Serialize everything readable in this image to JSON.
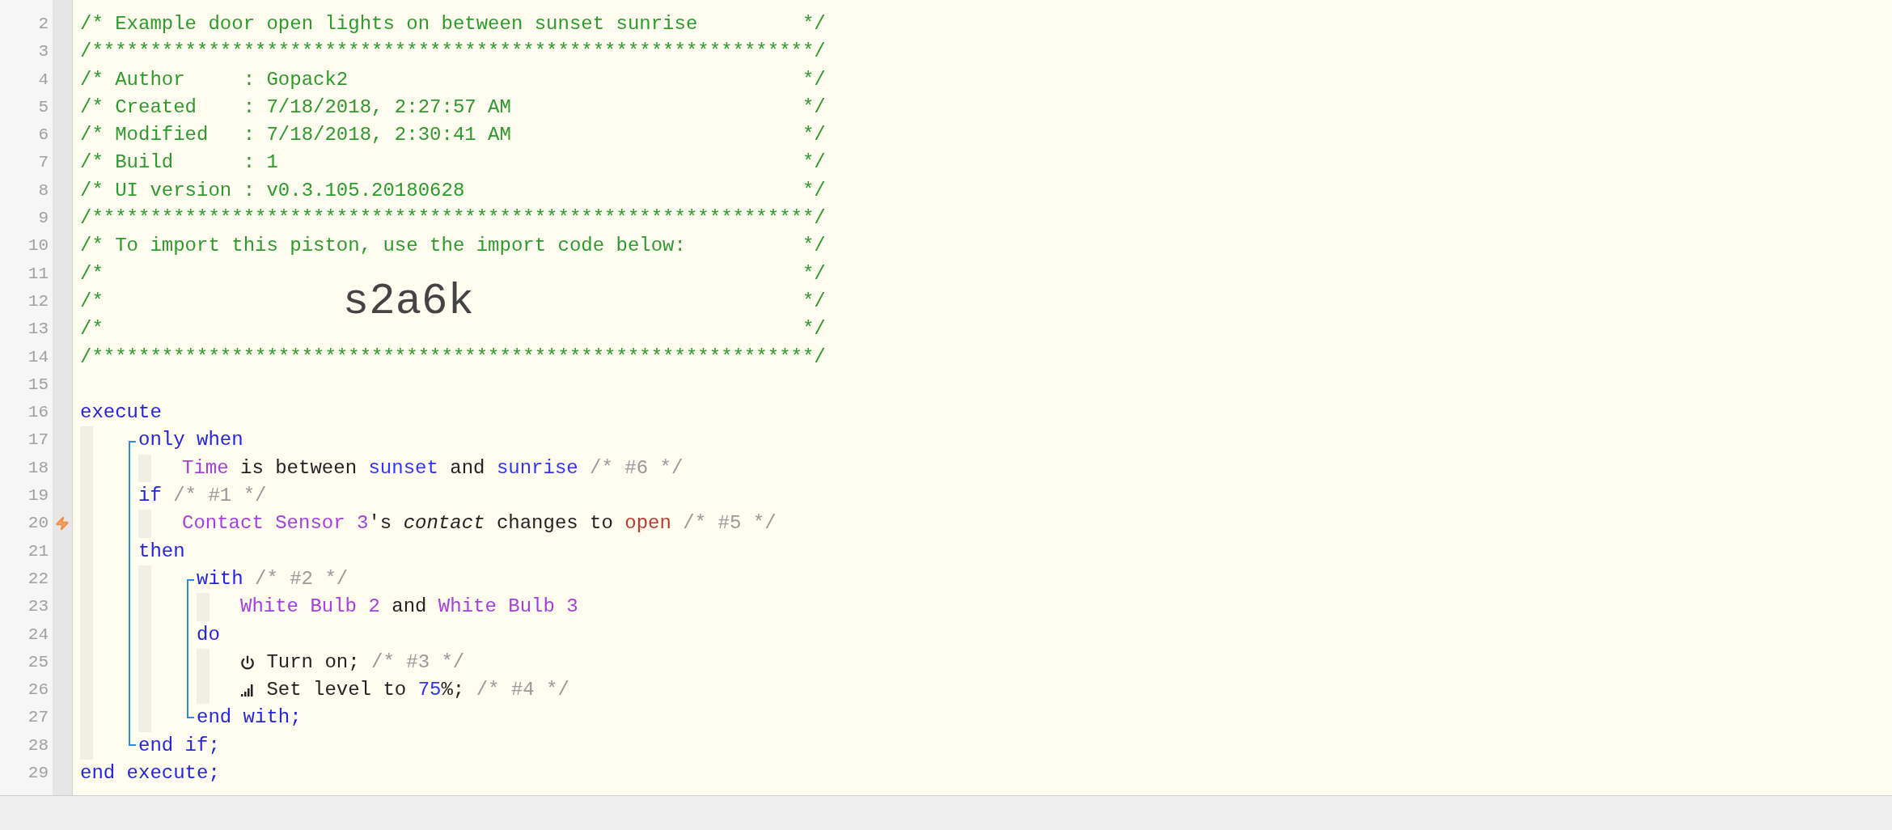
{
  "editor": {
    "header_lines": [
      {
        "number": "2",
        "trigger": false,
        "cols": [
          "/* Example door open lights on between sunset sunrise",
          "*/"
        ]
      },
      {
        "number": "3",
        "trigger": false,
        "cols": [
          "/**************************************************************/"
        ]
      },
      {
        "number": "4",
        "trigger": false,
        "cols": [
          "/* Author     : Gopack2",
          "*/"
        ]
      },
      {
        "number": "5",
        "trigger": false,
        "cols": [
          "/* Created    : 7/18/2018, 2:27:57 AM",
          "*/"
        ]
      },
      {
        "number": "6",
        "trigger": false,
        "cols": [
          "/* Modified   : 7/18/2018, 2:30:41 AM",
          "*/"
        ]
      },
      {
        "number": "7",
        "trigger": false,
        "cols": [
          "/* Build      : 1",
          "*/"
        ]
      },
      {
        "number": "8",
        "trigger": false,
        "cols": [
          "/* UI version : v0.3.105.20180628",
          "*/"
        ]
      },
      {
        "number": "9",
        "trigger": false,
        "cols": [
          "/**************************************************************/"
        ]
      },
      {
        "number": "10",
        "trigger": false,
        "cols": [
          "/* To import this piston, use the import code below:",
          "*/"
        ]
      },
      {
        "number": "11",
        "trigger": false,
        "cols": [
          "/*",
          "*/"
        ]
      },
      {
        "number": "12",
        "trigger": false,
        "cols": [
          "/*",
          "*/"
        ],
        "import_code": "s2a6k"
      },
      {
        "number": "13",
        "trigger": false,
        "cols": [
          "/*",
          "*/"
        ]
      },
      {
        "number": "14",
        "trigger": false,
        "cols": [
          "/**************************************************************/"
        ]
      },
      {
        "number": "15",
        "trigger": false
      }
    ],
    "code": [
      {
        "number": "16",
        "trigger": false,
        "segments": [
          {
            "kind": "keyword",
            "text": "execute"
          }
        ],
        "children": [
          {
            "kind": "block",
            "children": [
              {
                "number": "17",
                "trigger": false,
                "segments": [
                  {
                    "kind": "keyword",
                    "text": "only when"
                  }
                ],
                "children": [
                  {
                    "number": "18",
                    "trigger": false,
                    "segments": [
                      {
                        "kind": "device",
                        "text": "Time"
                      },
                      {
                        "kind": "plain",
                        "text": " is between "
                      },
                      {
                        "kind": "value",
                        "text": "sunset"
                      },
                      {
                        "kind": "plain",
                        "text": " and "
                      },
                      {
                        "kind": "value",
                        "text": "sunrise"
                      },
                      {
                        "kind": "note",
                        "text": " /* #6 */"
                      }
                    ]
                  }
                ]
              },
              {
                "number": "19",
                "trigger": false,
                "segments": [
                  {
                    "kind": "keyword",
                    "text": "if"
                  },
                  {
                    "kind": "note",
                    "text": " /* #1 */"
                  }
                ],
                "children": [
                  {
                    "number": "20",
                    "trigger": true,
                    "segments": [
                      {
                        "kind": "device",
                        "text": "Contact Sensor 3"
                      },
                      {
                        "kind": "plain",
                        "text": "'s "
                      },
                      {
                        "kind": "italic",
                        "text": "contact"
                      },
                      {
                        "kind": "plain",
                        "text": " changes to "
                      },
                      {
                        "kind": "state",
                        "text": "open"
                      },
                      {
                        "kind": "note",
                        "text": " /* #5 */"
                      }
                    ]
                  }
                ]
              },
              {
                "number": "21",
                "trigger": false,
                "segments": [
                  {
                    "kind": "keyword",
                    "text": "then"
                  }
                ],
                "children": [
                  {
                    "kind": "block",
                    "children": [
                      {
                        "number": "22",
                        "trigger": false,
                        "segments": [
                          {
                            "kind": "keyword",
                            "text": "with"
                          },
                          {
                            "kind": "note",
                            "text": " /* #2 */"
                          }
                        ],
                        "children": [
                          {
                            "number": "23",
                            "trigger": false,
                            "segments": [
                              {
                                "kind": "device",
                                "text": "White Bulb 2"
                              },
                              {
                                "kind": "plain",
                                "text": " and "
                              },
                              {
                                "kind": "device",
                                "text": "White Bulb 3"
                              }
                            ]
                          }
                        ]
                      },
                      {
                        "number": "24",
                        "trigger": false,
                        "segments": [
                          {
                            "kind": "keyword",
                            "text": "do"
                          }
                        ],
                        "children": [
                          {
                            "number": "25",
                            "trigger": false,
                            "segments": [
                              {
                                "kind": "power_icon"
                              },
                              {
                                "kind": "plain",
                                "text": " Turn on;"
                              },
                              {
                                "kind": "note",
                                "text": " /* #3 */"
                              }
                            ]
                          },
                          {
                            "number": "26",
                            "trigger": false,
                            "segments": [
                              {
                                "kind": "level_icon"
                              },
                              {
                                "kind": "plain",
                                "text": " Set level to "
                              },
                              {
                                "kind": "value",
                                "text": "75"
                              },
                              {
                                "kind": "plain",
                                "text": "%;"
                              },
                              {
                                "kind": "note",
                                "text": " /* #4 */"
                              }
                            ]
                          }
                        ]
                      },
                      {
                        "number": "27",
                        "trigger": false,
                        "segments": [
                          {
                            "kind": "keyword",
                            "text": "end with;"
                          }
                        ]
                      }
                    ]
                  }
                ]
              },
              {
                "number": "28",
                "trigger": false,
                "segments": [
                  {
                    "kind": "keyword",
                    "text": "end if;"
                  }
                ]
              }
            ]
          }
        ]
      },
      {
        "number": "29",
        "trigger": false,
        "segments": [
          {
            "kind": "keyword",
            "text": "end execute;"
          }
        ]
      }
    ]
  }
}
